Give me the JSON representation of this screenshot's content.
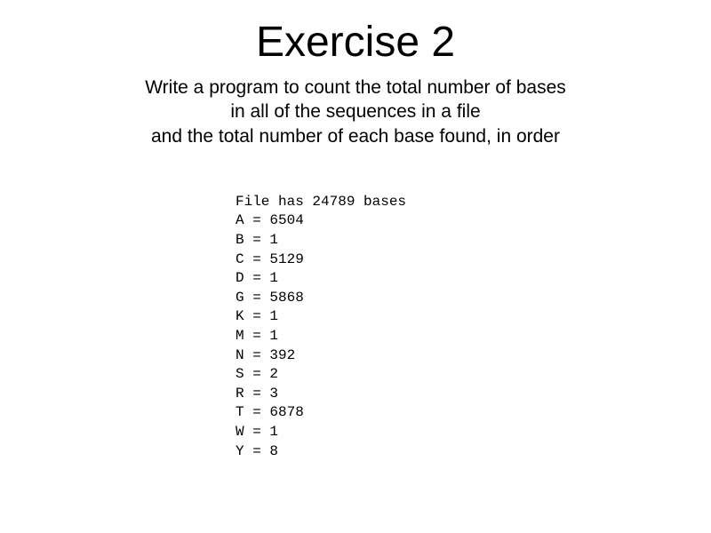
{
  "title": "Exercise 2",
  "description_line1": "Write a program to count the total number of bases",
  "description_line2": "in all of the sequences in a file",
  "description_line3": "and the total number of each base found, in order",
  "output_header": "File has 24789 bases",
  "base_counts": [
    {
      "base": "A",
      "count": 6504
    },
    {
      "base": "B",
      "count": 1
    },
    {
      "base": "C",
      "count": 5129
    },
    {
      "base": "D",
      "count": 1
    },
    {
      "base": "G",
      "count": 5868
    },
    {
      "base": "K",
      "count": 1
    },
    {
      "base": "M",
      "count": 1
    },
    {
      "base": "N",
      "count": 392
    },
    {
      "base": "S",
      "count": 2
    },
    {
      "base": "R",
      "count": 3
    },
    {
      "base": "T",
      "count": 6878
    },
    {
      "base": "W",
      "count": 1
    },
    {
      "base": "Y",
      "count": 8
    }
  ]
}
